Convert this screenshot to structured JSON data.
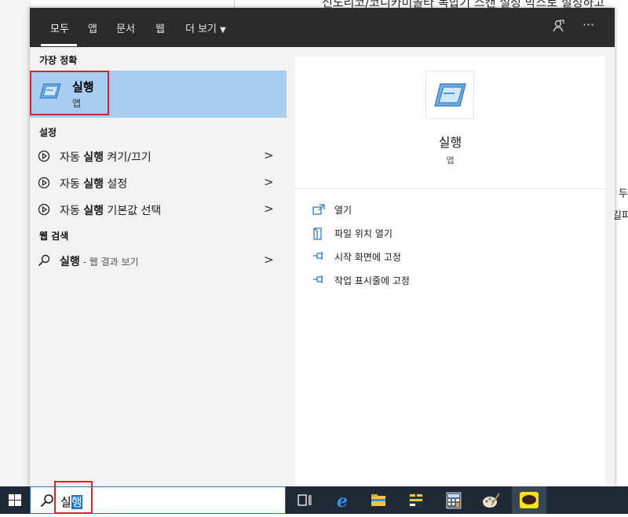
{
  "background": {
    "top_text": "신도리코/코니카미놀타 복합기 스캔 설정 박스로 설정하고",
    "right_text_1": "두",
    "right_text_2": "길파"
  },
  "tabs": [
    "모두",
    "앱",
    "문서",
    "웹",
    "더 보기"
  ],
  "top_icons": [
    "feedback-icon",
    "more-icon"
  ],
  "more_label": "···",
  "sections": {
    "best_match": "가장 정확",
    "settings": "설정",
    "web_search": "웹 검색"
  },
  "best_match": {
    "name": "실행",
    "type": "앱",
    "icon": "run-app-icon"
  },
  "settings_items": [
    {
      "pre": "자동 ",
      "bold": "실행",
      "post": " 켜기/끄기"
    },
    {
      "pre": "자동 ",
      "bold": "실행",
      "post": " 설정"
    },
    {
      "pre": "자동 ",
      "bold": "실행",
      "post": " 기본값 선택"
    }
  ],
  "web_item": {
    "bold": "실행",
    "muted": " - 웹 결과 보기"
  },
  "detail": {
    "title": "실행",
    "type": "앱",
    "actions": [
      {
        "label": "열기",
        "icon": "open-icon"
      },
      {
        "label": "파일 위치 열기",
        "icon": "file-location-icon"
      },
      {
        "label": "시작 화면에 고정",
        "icon": "pin-icon"
      },
      {
        "label": "작업 표시줄에 고정",
        "icon": "pin-icon"
      }
    ]
  },
  "search": {
    "typed_plain": "실",
    "typed_selected": "행"
  },
  "taskbar_apps": [
    "task-view-icon",
    "edge-icon",
    "file-explorer-icon",
    "custom-app-icon",
    "calculator-icon",
    "paint-icon",
    "kakaotalk-icon"
  ],
  "colors": {
    "accent": "#1e73d2",
    "highlight": "#a9cdf0",
    "topbar": "#2b2b2b",
    "taskbar": "#1f2a36",
    "annotation": "#d9232e"
  }
}
